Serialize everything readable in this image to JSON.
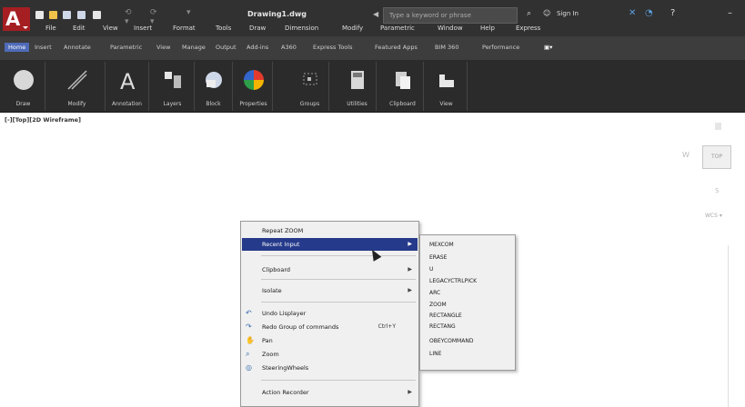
{
  "title_bar": {
    "doc_title": "Drawing1.dwg",
    "search_placeholder": "Type a keyword or phrase",
    "signin_label": "Sign In",
    "qat_undo": "⟲ ▾",
    "qat_redo": "⟳ ▾",
    "qat_more": "▾"
  },
  "menubar": [
    "File",
    "Edit",
    "View",
    "Insert",
    "Format",
    "Tools",
    "Draw",
    "Dimension",
    "Modify",
    "Parametric",
    "Window",
    "Help",
    "Express"
  ],
  "ribbon_tabs": [
    "Home",
    "Insert",
    "Annotate",
    "Parametric",
    "View",
    "Manage",
    "Output",
    "Add-ins",
    "A360",
    "Express Tools",
    "Featured Apps",
    "BIM 360",
    "Performance"
  ],
  "ribbon_panels": [
    {
      "label": "Draw",
      "icon": "draw-icon"
    },
    {
      "label": "Modify",
      "icon": "modify-icon"
    },
    {
      "label": "Annotation",
      "icon": "annotation-icon"
    },
    {
      "label": "Layers",
      "icon": "layers-icon"
    },
    {
      "label": "Block",
      "icon": "block-icon"
    },
    {
      "label": "Properties",
      "icon": "properties-icon"
    },
    {
      "label": "Groups",
      "icon": "groups-icon"
    },
    {
      "label": "Utilities",
      "icon": "utilities-icon"
    },
    {
      "label": "Clipboard",
      "icon": "clipboard-icon"
    },
    {
      "label": "View",
      "icon": "view-icon"
    }
  ],
  "drawing_area": {
    "viewport_label": "[-][Top][2D Wireframe]",
    "viewcube_face": "TOP",
    "viewcube_west": "W",
    "viewcube_south": "S",
    "wcs_label": "WCS ▾"
  },
  "context_menu": {
    "items": [
      {
        "label": "Repeat ZOOM",
        "has_submenu": false,
        "highlight": false,
        "icon": ""
      },
      {
        "label": "Recent Input",
        "has_submenu": true,
        "highlight": true,
        "icon": ""
      },
      {
        "label": "Clipboard",
        "has_submenu": true,
        "highlight": false,
        "icon": ""
      },
      {
        "label": "Isolate",
        "has_submenu": true,
        "highlight": false,
        "icon": ""
      },
      {
        "label": "Undo Lisplayer",
        "has_submenu": false,
        "highlight": false,
        "icon": "undo-icon"
      },
      {
        "label": "Redo Group of commands",
        "shortcut": "Ctrl+Y",
        "has_submenu": false,
        "highlight": false,
        "icon": "redo-icon"
      },
      {
        "label": "Pan",
        "has_submenu": false,
        "highlight": false,
        "icon": "pan-icon"
      },
      {
        "label": "Zoom",
        "has_submenu": false,
        "highlight": false,
        "icon": "zoom-icon"
      },
      {
        "label": "SteeringWheels",
        "has_submenu": false,
        "highlight": false,
        "icon": "steeringwheels-icon"
      },
      {
        "label": "Action Recorder",
        "has_submenu": true,
        "highlight": false,
        "icon": ""
      }
    ]
  },
  "recent_input_submenu": [
    "MEXCOM",
    "ERASE",
    "U",
    "LEGACYCTRLPICK",
    "ARC",
    "ZOOM",
    "RECTANGLE",
    "RECTANG",
    "OBEYCOMMAND",
    "LINE"
  ]
}
